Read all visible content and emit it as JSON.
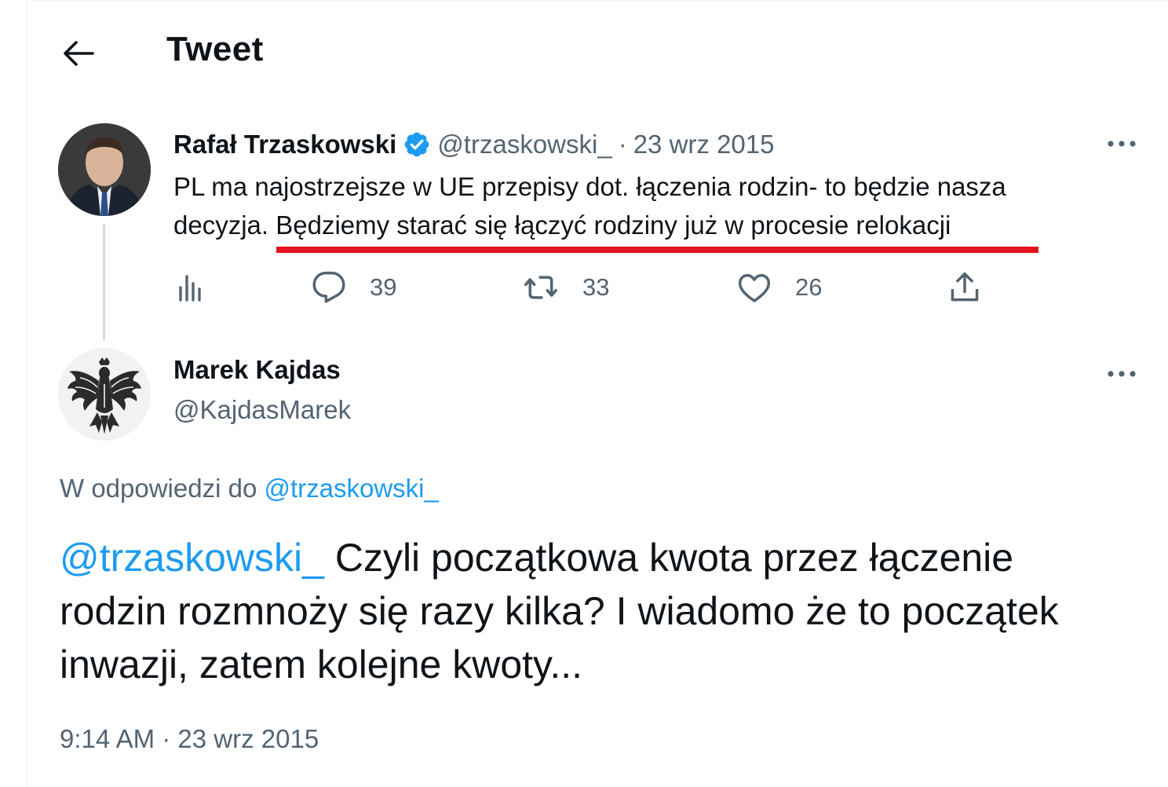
{
  "header": {
    "title": "Tweet"
  },
  "tweet": {
    "author_name": "Rafał Trzaskowski",
    "author_handle": "@trzaskowski_",
    "separator": "·",
    "date": "23 wrz 2015",
    "text_part1": "PL ma najostrzejsze w UE przepisy dot. łączenia rodzin- to będzie nasza decyzja. ",
    "text_part2": "Będziemy starać się łączyć rodziny już w procesie relokacji",
    "metrics": {
      "replies": "39",
      "retweets": "33",
      "likes": "26"
    }
  },
  "reply": {
    "author_name": "Marek Kajdas",
    "author_handle": "@KajdasMarek",
    "reply_to_label": "W odpowiedzi do ",
    "reply_to_handle": "@trzaskowski_",
    "mention": "@trzaskowski_",
    "text": " Czyli początkowa kwota przez łączenie rodzin rozmnoży się razy kilka? I wiadomo że to początek inwazji, zatem kolejne kwoty...",
    "time": "9:14 AM",
    "separator": " · ",
    "date": "23 wrz 2015"
  },
  "colors": {
    "accent": "#1d9bf0",
    "secondary_text": "#536471",
    "highlight_underline": "#e3131b"
  }
}
